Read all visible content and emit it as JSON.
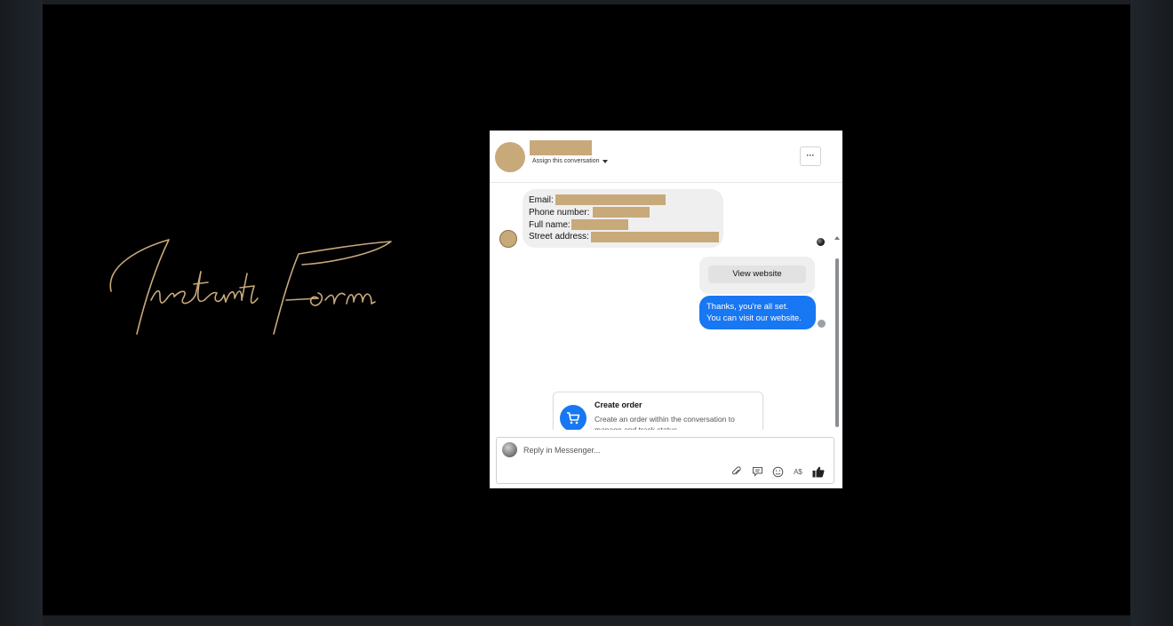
{
  "slide": {
    "title": "Instant Form",
    "accent_color": "#c8a97a",
    "background": "#000000"
  },
  "messenger": {
    "header": {
      "assign_label": "Assign this conversation",
      "more_label": "···"
    },
    "lead_form": {
      "email_label": "Email:",
      "phone_label": "Phone number:",
      "name_label": "Full name:",
      "address_label": "Street address:"
    },
    "view_website_label": "View website",
    "outgoing_message": {
      "line1": "Thanks, you're all set.",
      "line2": "You can visit our website."
    },
    "create_order": {
      "title": "Create order",
      "description": "Create an order within the conversation to manage and track status"
    },
    "composer": {
      "placeholder": "Reply in Messenger...",
      "tools": [
        "paperclip-icon",
        "saved-reply-icon",
        "emoji-icon",
        "currency-icon",
        "thumbs-up-icon"
      ],
      "currency_label": "A$"
    },
    "brand_blue": "#1877f2"
  }
}
